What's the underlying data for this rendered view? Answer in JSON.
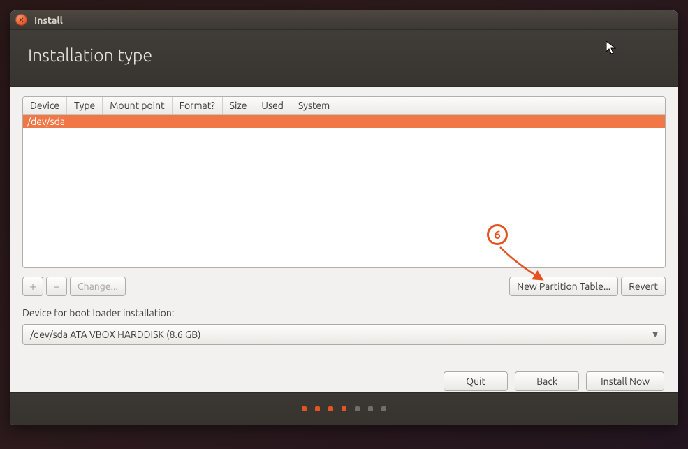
{
  "titlebar": {
    "title": "Install"
  },
  "header": {
    "title": "Installation type"
  },
  "table": {
    "headers": [
      "Device",
      "Type",
      "Mount point",
      "Format?",
      "Size",
      "Used",
      "System"
    ],
    "rows": [
      {
        "device": "/dev/sda",
        "selected": true
      }
    ]
  },
  "toolbar": {
    "add_label": "+",
    "remove_label": "−",
    "change_label": "Change...",
    "new_pt_label": "New Partition Table...",
    "revert_label": "Revert"
  },
  "bootloader": {
    "label": "Device for boot loader installation:",
    "selected": "/dev/sda  ATA VBOX HARDDISK (8.6 GB)"
  },
  "actions": {
    "quit": "Quit",
    "back": "Back",
    "install": "Install Now"
  },
  "annotation": {
    "step": "6"
  },
  "progress_dots": {
    "total": 7,
    "active": 4
  }
}
